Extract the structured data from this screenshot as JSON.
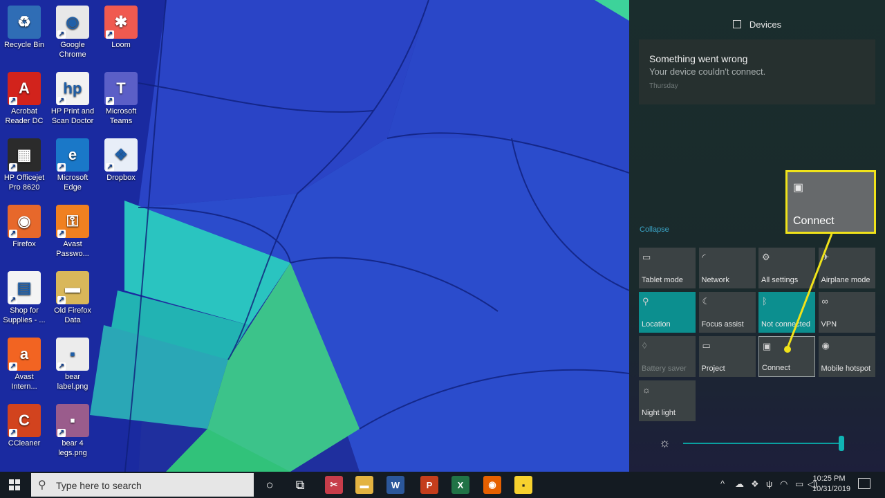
{
  "desktop": {
    "icons": [
      {
        "label": "Recycle Bin",
        "icon": "recycle-bin-icon"
      },
      {
        "label": "Google Chrome",
        "icon": "chrome-icon"
      },
      {
        "label": "Loom",
        "icon": "loom-icon"
      },
      {
        "label": "Acrobat Reader DC",
        "icon": "acrobat-icon"
      },
      {
        "label": "HP Print and Scan Doctor",
        "icon": "hp-icon"
      },
      {
        "label": "Microsoft Teams",
        "icon": "teams-icon"
      },
      {
        "label": "HP Officejet Pro 8620",
        "icon": "printer-icon"
      },
      {
        "label": "Microsoft Edge",
        "icon": "edge-icon"
      },
      {
        "label": "Dropbox",
        "icon": "dropbox-icon"
      },
      {
        "label": "Firefox",
        "icon": "firefox-icon"
      },
      {
        "label": "Avast Passwo...",
        "icon": "avast-passwords-icon"
      },
      {
        "label": "Shop for Supplies - ...",
        "icon": "shop-supplies-icon"
      },
      {
        "label": "Old Firefox Data",
        "icon": "folder-icon"
      },
      {
        "label": "Avast Intern...",
        "icon": "avast-icon"
      },
      {
        "label": "bear label.png",
        "icon": "image-file-icon"
      },
      {
        "label": "CCleaner",
        "icon": "ccleaner-icon"
      },
      {
        "label": "bear 4 legs.png",
        "icon": "image-file-icon"
      }
    ]
  },
  "action_center": {
    "header": "Devices",
    "notification": {
      "title": "Something went wrong",
      "body": "Your device couldn't connect.",
      "time": "Thursday"
    },
    "collapse_label": "Collapse",
    "tiles": [
      {
        "label": "Tablet mode",
        "icon": "tablet-icon",
        "glyph": "▭",
        "state": "normal"
      },
      {
        "label": "Network",
        "icon": "network-icon",
        "glyph": "◜",
        "state": "normal"
      },
      {
        "label": "All settings",
        "icon": "gear-icon",
        "glyph": "⚙",
        "state": "normal"
      },
      {
        "label": "Airplane mode",
        "icon": "airplane-icon",
        "glyph": "✈",
        "state": "normal"
      },
      {
        "label": "Location",
        "icon": "location-icon",
        "glyph": "⚲",
        "state": "active"
      },
      {
        "label": "Focus assist",
        "icon": "moon-icon",
        "glyph": "☾",
        "state": "normal"
      },
      {
        "label": "Not connected",
        "icon": "bluetooth-icon",
        "glyph": "ᛒ",
        "state": "active"
      },
      {
        "label": "VPN",
        "icon": "vpn-icon",
        "glyph": "∞",
        "state": "normal"
      },
      {
        "label": "Battery saver",
        "icon": "battery-saver-icon",
        "glyph": "◊",
        "state": "disabled"
      },
      {
        "label": "Project",
        "icon": "project-icon",
        "glyph": "▭",
        "state": "normal"
      },
      {
        "label": "Connect",
        "icon": "connect-icon",
        "glyph": "▣",
        "state": "focused"
      },
      {
        "label": "Mobile hotspot",
        "icon": "hotspot-icon",
        "glyph": "◉",
        "state": "normal"
      },
      {
        "label": "Night light",
        "icon": "sun-icon",
        "glyph": "☼",
        "state": "normal"
      }
    ],
    "callout": {
      "label": "Connect",
      "icon": "connect-icon",
      "glyph": "▣"
    },
    "brightness": {
      "icon": "brightness-icon",
      "glyph": "☼",
      "level_percent": 100
    }
  },
  "taskbar": {
    "search_placeholder": "Type here to search",
    "search_icon_glyph": "⚲",
    "apps": [
      {
        "name": "cortana-icon",
        "glyph": "○",
        "color": "transparent"
      },
      {
        "name": "task-view-icon",
        "glyph": "⧉",
        "color": "transparent"
      },
      {
        "name": "snipping-tool-icon",
        "glyph": "✂",
        "color": "#c73d4a"
      },
      {
        "name": "file-explorer-icon",
        "glyph": "▬",
        "color": "#e3b341"
      },
      {
        "name": "word-icon",
        "glyph": "W",
        "color": "#2b579a"
      },
      {
        "name": "powerpoint-icon",
        "glyph": "P",
        "color": "#c43e1c"
      },
      {
        "name": "excel-icon",
        "glyph": "X",
        "color": "#217346"
      },
      {
        "name": "firefox-taskbar-icon",
        "glyph": "◉",
        "color": "#e66000"
      },
      {
        "name": "sticky-notes-icon",
        "glyph": "▪",
        "color": "#f7d12e"
      }
    ],
    "tray": [
      {
        "name": "chevron-up-icon",
        "glyph": "^"
      },
      {
        "name": "onedrive-icon",
        "glyph": "☁"
      },
      {
        "name": "dropbox-tray-icon",
        "glyph": "❖"
      },
      {
        "name": "usb-icon",
        "glyph": "ψ"
      },
      {
        "name": "wifi-icon",
        "glyph": "◠"
      },
      {
        "name": "battery-icon",
        "glyph": "▭"
      },
      {
        "name": "volume-icon",
        "glyph": "◁)"
      }
    ],
    "time": "10:25 PM",
    "date": "10/31/2019",
    "notification_icon": "notification-icon"
  }
}
